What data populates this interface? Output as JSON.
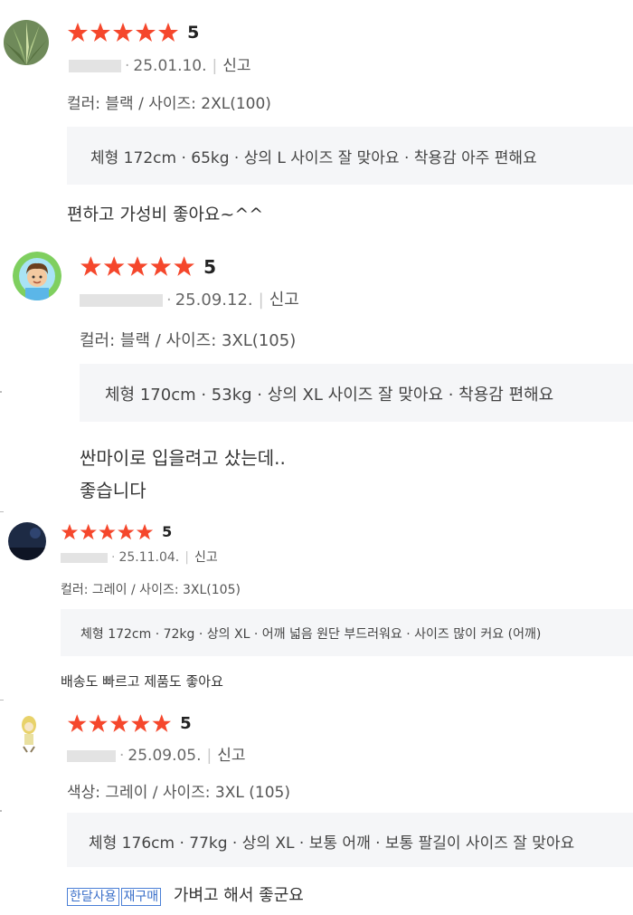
{
  "reviews": [
    {
      "avatar": "plant-photo",
      "rating": "5",
      "date": "25.01.10.",
      "report": "신고",
      "option": "컬러: 블랙 / 사이즈: 2XL(100)",
      "info": "체형 172cm · 65kg · 상의 L  사이즈 잘 맞아요 · 착용감 아주 편해요",
      "body": [
        "편하고 가성비 좋아요~^^"
      ]
    },
    {
      "avatar": "cartoon-man",
      "rating": "5",
      "date": "25.09.12.",
      "report": "신고",
      "option": "컬러: 블랙 / 사이즈: 3XL(105)",
      "info": "체형 170cm · 53kg · 상의 XL  사이즈 잘 맞아요 · 착용감 편해요",
      "body": [
        "싼마이로 입을려고 샀는데..",
        "좋습니다"
      ]
    },
    {
      "avatar": "dark-sky-photo",
      "rating": "5",
      "date": "25.11.04.",
      "report": "신고",
      "option": "컬러: 그레이 / 사이즈: 3XL(105)",
      "info": "체형 172cm · 72kg · 상의 XL · 어깨 넓음  원단 부드러워요 · 사이즈 많이 커요 (어깨)",
      "body": [
        "배송도 빠르고 제품도 좋아요"
      ]
    },
    {
      "avatar": "cartoon-figure",
      "rating": "5",
      "date": "25.09.05.",
      "report": "신고",
      "option": "색상: 그레이 / 사이즈: 3XL (105)",
      "info": "체형 176cm · 77kg · 상의 XL · 보통 어깨 · 보통 팔길이  사이즈 잘 맞아요",
      "tags": [
        "한달사용",
        "재구매"
      ],
      "body": [
        "가벼고 해서 좋군요"
      ]
    }
  ],
  "colors": {
    "star": "#f5472c",
    "tag": "#3a6fc9",
    "box": "#f5f6f8"
  }
}
